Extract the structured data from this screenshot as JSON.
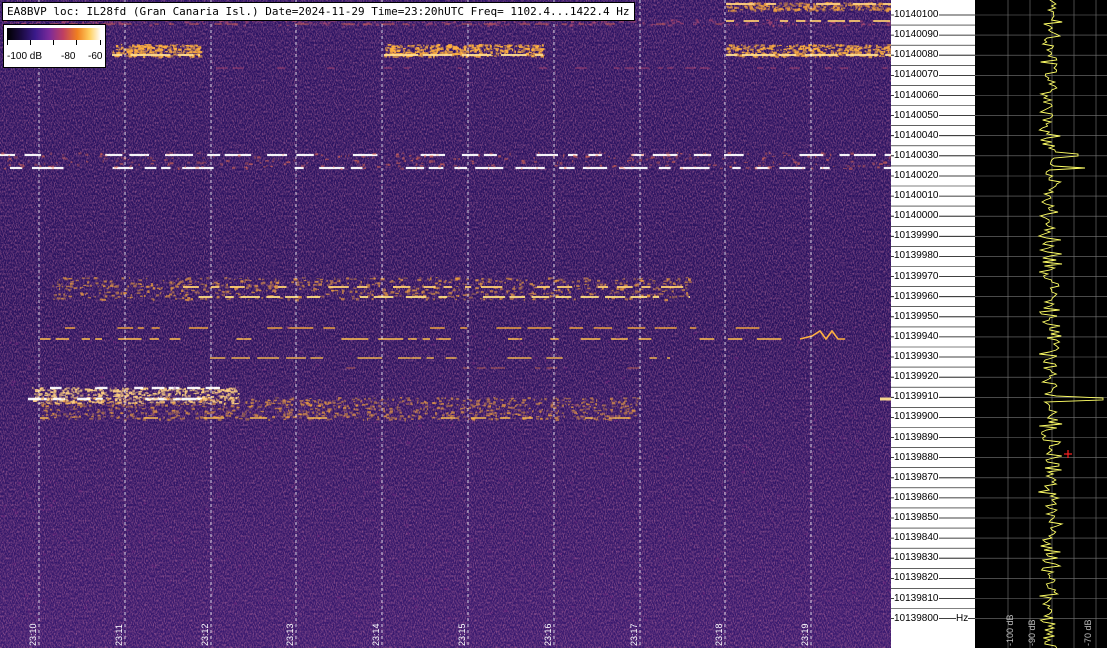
{
  "title": "EA8BVP loc: IL28fd (Gran Canaria Isl.) Date=2024-11-29 Time=23:20hUTC Freq= 1102.4...1422.4 Hz",
  "legend": {
    "labels": [
      "-100 dB",
      "-80",
      "-60"
    ]
  },
  "time_axis": {
    "labels": [
      "23:10",
      "23:11",
      "23:12",
      "23:13",
      "23:14",
      "23:15",
      "23:16",
      "23:17",
      "23:18",
      "23:19"
    ]
  },
  "freq_axis": {
    "labels": [
      "10140100",
      "10140090",
      "10140080",
      "10140070",
      "10140060",
      "10140050",
      "10140040",
      "10140030",
      "10140020",
      "10140010",
      "10140000",
      "10139990",
      "10139980",
      "10139970",
      "10139960",
      "10139950",
      "10139940",
      "10139930",
      "10139920",
      "10139910",
      "10139900",
      "10139890",
      "10139880",
      "10139870",
      "10139860",
      "10139850",
      "10139840",
      "10139830",
      "10139820",
      "10139810",
      "10139800"
    ],
    "unit": "Hz"
  },
  "spectrum": {
    "db_labels": [
      "-100 dB",
      "-90 dB",
      "-70 dB"
    ]
  },
  "colors": {
    "background": "#2a1360",
    "signal_hot": "#ffe9a0",
    "signal_warm": "#f0a040",
    "gridline": "#ffffff",
    "trace": "#ffff66",
    "marker": "#ff2020"
  }
}
